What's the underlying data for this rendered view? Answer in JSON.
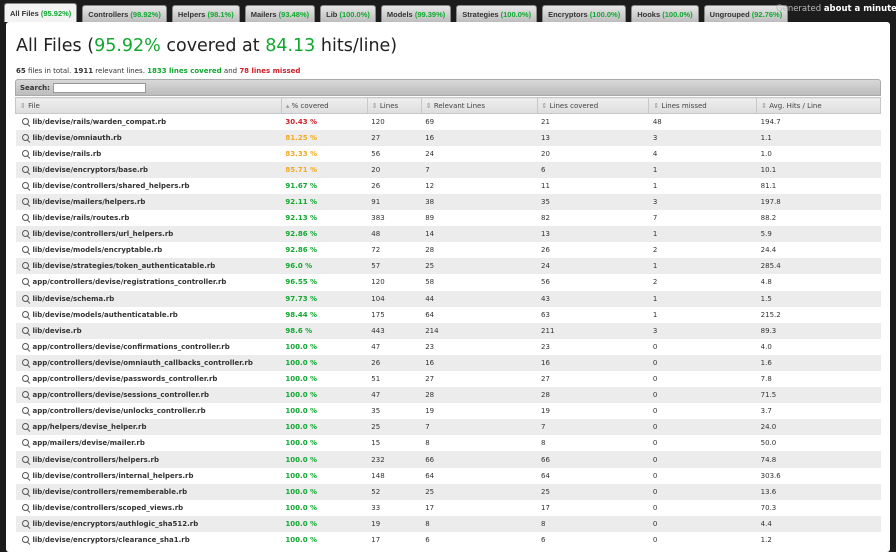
{
  "tabs": [
    {
      "label": "All Files",
      "pct": "(95.92%)"
    },
    {
      "label": "Controllers",
      "pct": "(98.92%)"
    },
    {
      "label": "Helpers",
      "pct": "(98.1%)"
    },
    {
      "label": "Mailers",
      "pct": "(93.48%)"
    },
    {
      "label": "Lib",
      "pct": "(100.0%)"
    },
    {
      "label": "Models",
      "pct": "(99.39%)"
    },
    {
      "label": "Strategies",
      "pct": "(100.0%)"
    },
    {
      "label": "Encryptors",
      "pct": "(100.0%)"
    },
    {
      "label": "Hooks",
      "pct": "(100.0%)"
    },
    {
      "label": "Ungrouped",
      "pct": "(92.76%)"
    }
  ],
  "generated": {
    "prefix": "Generated",
    "value": "about a minute ago"
  },
  "title": {
    "prefix": "All Files (",
    "percent": "95.92%",
    "mid": " covered at ",
    "hits": "84.13",
    "suffix": " hits/line)"
  },
  "summary": {
    "files": "65",
    "files_text": " files in total. ",
    "relevant": "1911",
    "relevant_text": " relevant lines. ",
    "covered": "1833 lines covered",
    "and": " and ",
    "missed": "78 lines missed"
  },
  "search": {
    "label": "Search:",
    "value": ""
  },
  "columns": [
    "File",
    "% covered",
    "Lines",
    "Relevant Lines",
    "Lines covered",
    "Lines missed",
    "Avg. Hits / Line"
  ],
  "rows": [
    [
      "lib/devise/rails/warden_compat.rb",
      "30.43 %",
      "120",
      "69",
      "21",
      "48",
      "194.7",
      "red"
    ],
    [
      "lib/devise/omniauth.rb",
      "81.25 %",
      "27",
      "16",
      "13",
      "3",
      "1.1",
      "yellow"
    ],
    [
      "lib/devise/rails.rb",
      "83.33 %",
      "56",
      "24",
      "20",
      "4",
      "1.0",
      "yellow"
    ],
    [
      "lib/devise/encryptors/base.rb",
      "85.71 %",
      "20",
      "7",
      "6",
      "1",
      "10.1",
      "yellow"
    ],
    [
      "lib/devise/controllers/shared_helpers.rb",
      "91.67 %",
      "26",
      "12",
      "11",
      "1",
      "81.1",
      "green"
    ],
    [
      "lib/devise/mailers/helpers.rb",
      "92.11 %",
      "91",
      "38",
      "35",
      "3",
      "197.8",
      "green"
    ],
    [
      "lib/devise/rails/routes.rb",
      "92.13 %",
      "383",
      "89",
      "82",
      "7",
      "88.2",
      "green"
    ],
    [
      "lib/devise/controllers/url_helpers.rb",
      "92.86 %",
      "48",
      "14",
      "13",
      "1",
      "5.9",
      "green"
    ],
    [
      "lib/devise/models/encryptable.rb",
      "92.86 %",
      "72",
      "28",
      "26",
      "2",
      "24.4",
      "green"
    ],
    [
      "lib/devise/strategies/token_authenticatable.rb",
      "96.0 %",
      "57",
      "25",
      "24",
      "1",
      "285.4",
      "green"
    ],
    [
      "app/controllers/devise/registrations_controller.rb",
      "96.55 %",
      "120",
      "58",
      "56",
      "2",
      "4.8",
      "green"
    ],
    [
      "lib/devise/schema.rb",
      "97.73 %",
      "104",
      "44",
      "43",
      "1",
      "1.5",
      "green"
    ],
    [
      "lib/devise/models/authenticatable.rb",
      "98.44 %",
      "175",
      "64",
      "63",
      "1",
      "215.2",
      "green"
    ],
    [
      "lib/devise.rb",
      "98.6 %",
      "443",
      "214",
      "211",
      "3",
      "89.3",
      "green"
    ],
    [
      "app/controllers/devise/confirmations_controller.rb",
      "100.0 %",
      "47",
      "23",
      "23",
      "0",
      "4.0",
      "green"
    ],
    [
      "app/controllers/devise/omniauth_callbacks_controller.rb",
      "100.0 %",
      "26",
      "16",
      "16",
      "0",
      "1.6",
      "green"
    ],
    [
      "app/controllers/devise/passwords_controller.rb",
      "100.0 %",
      "51",
      "27",
      "27",
      "0",
      "7.8",
      "green"
    ],
    [
      "app/controllers/devise/sessions_controller.rb",
      "100.0 %",
      "47",
      "28",
      "28",
      "0",
      "71.5",
      "green"
    ],
    [
      "app/controllers/devise/unlocks_controller.rb",
      "100.0 %",
      "35",
      "19",
      "19",
      "0",
      "3.7",
      "green"
    ],
    [
      "app/helpers/devise_helper.rb",
      "100.0 %",
      "25",
      "7",
      "7",
      "0",
      "24.0",
      "green"
    ],
    [
      "app/mailers/devise/mailer.rb",
      "100.0 %",
      "15",
      "8",
      "8",
      "0",
      "50.0",
      "green"
    ],
    [
      "lib/devise/controllers/helpers.rb",
      "100.0 %",
      "232",
      "66",
      "66",
      "0",
      "74.8",
      "green"
    ],
    [
      "lib/devise/controllers/internal_helpers.rb",
      "100.0 %",
      "148",
      "64",
      "64",
      "0",
      "303.6",
      "green"
    ],
    [
      "lib/devise/controllers/rememberable.rb",
      "100.0 %",
      "52",
      "25",
      "25",
      "0",
      "13.6",
      "green"
    ],
    [
      "lib/devise/controllers/scoped_views.rb",
      "100.0 %",
      "33",
      "17",
      "17",
      "0",
      "70.3",
      "green"
    ],
    [
      "lib/devise/encryptors/authlogic_sha512.rb",
      "100.0 %",
      "19",
      "8",
      "8",
      "0",
      "4.4",
      "green"
    ],
    [
      "lib/devise/encryptors/clearance_sha1.rb",
      "100.0 %",
      "17",
      "6",
      "6",
      "0",
      "1.2",
      "green"
    ]
  ]
}
